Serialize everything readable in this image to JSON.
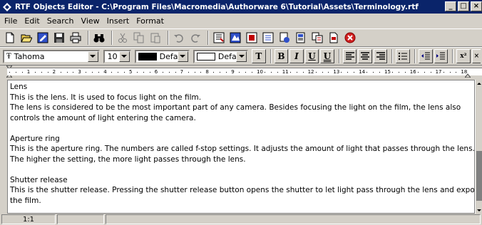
{
  "window": {
    "title": "RTF Objects Editor - C:\\Program Files\\Macromedia\\Authorware 6\\Tutorial\\Assets\\Terminology.rtf"
  },
  "menu": [
    "File",
    "Edit",
    "Search",
    "View",
    "Insert",
    "Format"
  ],
  "format_toolbar": {
    "font_name": "Tahoma",
    "font_size": "10",
    "text_color_label": "Default",
    "background_color_label": "Default",
    "font_glyph": "T",
    "bold": "B",
    "italic": "I",
    "underline": "U",
    "underline_alt": "U",
    "superscript": "x²",
    "subscript": "×"
  },
  "ruler": {
    "marks": [
      "1",
      "2",
      "3",
      "4",
      "5",
      "6",
      "7",
      "8",
      "9",
      "10",
      "11",
      "12",
      "13",
      "14",
      "15",
      "16",
      "17",
      "18"
    ]
  },
  "document": {
    "paragraphs": [
      {
        "heading": "Lens",
        "lines": [
          "This is the lens. It is used to focus light on the film.",
          "The lens is considered to be the most important part of any camera. Besides focusing the light on the film, the lens also",
          "controls the amount of light entering the camera."
        ]
      },
      {
        "heading": "Aperture ring",
        "lines": [
          "This is the aperture ring. The numbers are called f-stop settings. It adjusts the amount of light that passes through the lens.",
          "The higher the setting, the more light passes through the lens."
        ]
      },
      {
        "heading": "Shutter release",
        "lines": [
          "This is the shutter release. Pressing the shutter release button opens the shutter to let light pass through the lens and expose",
          "the film."
        ]
      }
    ]
  },
  "status": {
    "position": "1:1"
  },
  "colors": {
    "titlebar": "#0a246a",
    "face": "#d4d0c8",
    "editor_bg": "#ffffff"
  }
}
